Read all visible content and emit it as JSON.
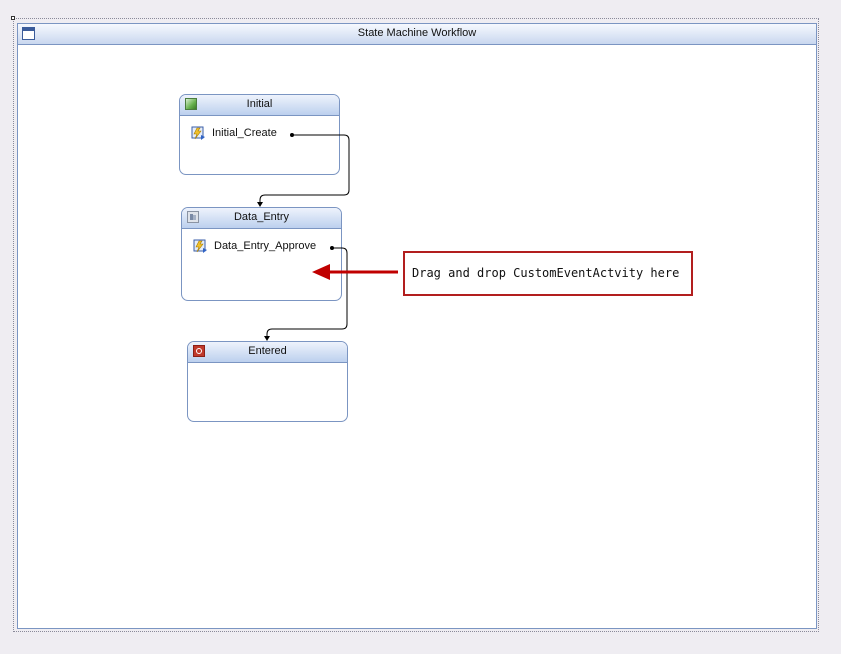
{
  "workflow": {
    "title": "State Machine Workflow"
  },
  "states": {
    "initial": {
      "title": "Initial",
      "icon": "initial-state-icon",
      "event_label": "Initial_Create"
    },
    "data_entry": {
      "title": "Data_Entry",
      "icon": "state-icon",
      "event_label": "Data_Entry_Approve"
    },
    "entered": {
      "title": "Entered",
      "icon": "completed-state-icon"
    }
  },
  "callout": {
    "text": "Drag and drop CustomEventActvity here",
    "border_color": "#b21e1e",
    "arrow_color": "#c00000"
  },
  "colors": {
    "header_blue": "#7b95c2",
    "background": "#efedf2"
  }
}
